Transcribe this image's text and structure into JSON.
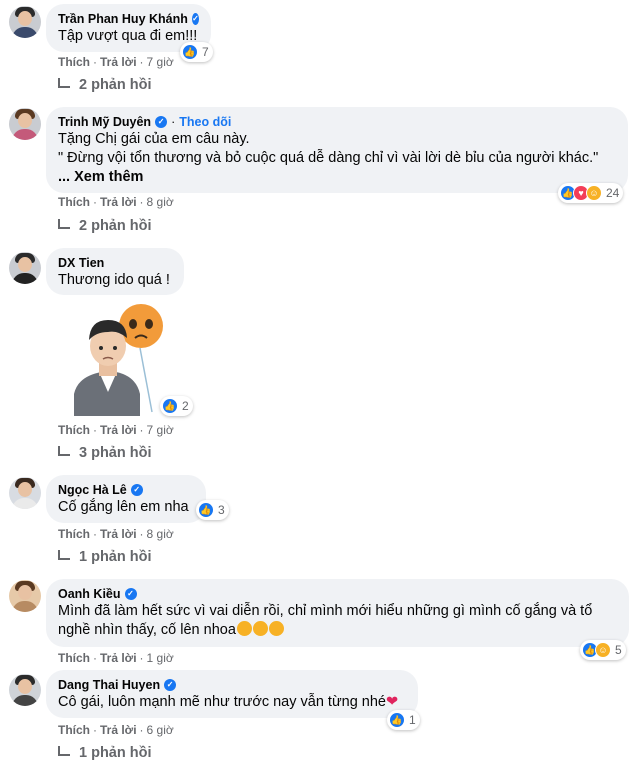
{
  "comments": [
    {
      "name": "Trần Phan Huy Khánh",
      "lines": [
        "Tập vượt qua đi em!!!"
      ],
      "reaction_count": "7",
      "like": "Thích",
      "reply": "Trả lời",
      "time": "7 giờ",
      "replies": "2 phản hồi"
    },
    {
      "name": "Trinh Mỹ Duyên",
      "follow": "Theo dõi",
      "lines": [
        "Tặng Chị gái của em câu này.",
        "\" Đừng vội tổn thương và bỏ cuộc quá dễ dàng chỉ vì vài lời dè bỉu của người khác.\""
      ],
      "see_more": "... Xem thêm",
      "reaction_count": "24",
      "like": "Thích",
      "reply": "Trả lời",
      "time": "8 giờ",
      "replies": "2 phản hồi"
    },
    {
      "name": "DX Tien",
      "lines": [
        "Thương ido quá !"
      ],
      "reaction_count": "2",
      "like": "Thích",
      "reply": "Trả lời",
      "time": "7 giờ",
      "replies": "3 phản hồi"
    },
    {
      "name": "Ngọc Hà Lê",
      "lines": [
        "Cố gắng lên em nha"
      ],
      "reaction_count": "3",
      "like": "Thích",
      "reply": "Trả lời",
      "time": "8 giờ",
      "replies": "1 phản hồi"
    },
    {
      "name": "Oanh Kiều",
      "lines": [
        "Mình đã làm hết sức vì vai diễn rồi, chỉ mình mới hiểu những gì mình cố gắng và tổ",
        "nghề nhìn thấy, cố lên nhoa"
      ],
      "reaction_count": "5",
      "like": "Thích",
      "reply": "Trả lời",
      "time": "1 giờ"
    },
    {
      "name": "Dang Thai Huyen",
      "lines": [
        "Cô gái, luôn mạnh mẽ như trước nay vẫn từng nhé"
      ],
      "reaction_count": "1",
      "like": "Thích",
      "reply": "Trả lời",
      "time": "6 giờ",
      "replies": "1 phản hồi"
    }
  ],
  "icons": {
    "verified": "verified-badge-icon",
    "like": "like-reaction-icon",
    "love": "love-reaction-icon",
    "care": "care-reaction-icon",
    "reply_arrow": "reply-arrow-icon"
  },
  "colors": {
    "accent": "#1877f2",
    "bubble": "#f0f2f5",
    "muted": "#65676b"
  }
}
